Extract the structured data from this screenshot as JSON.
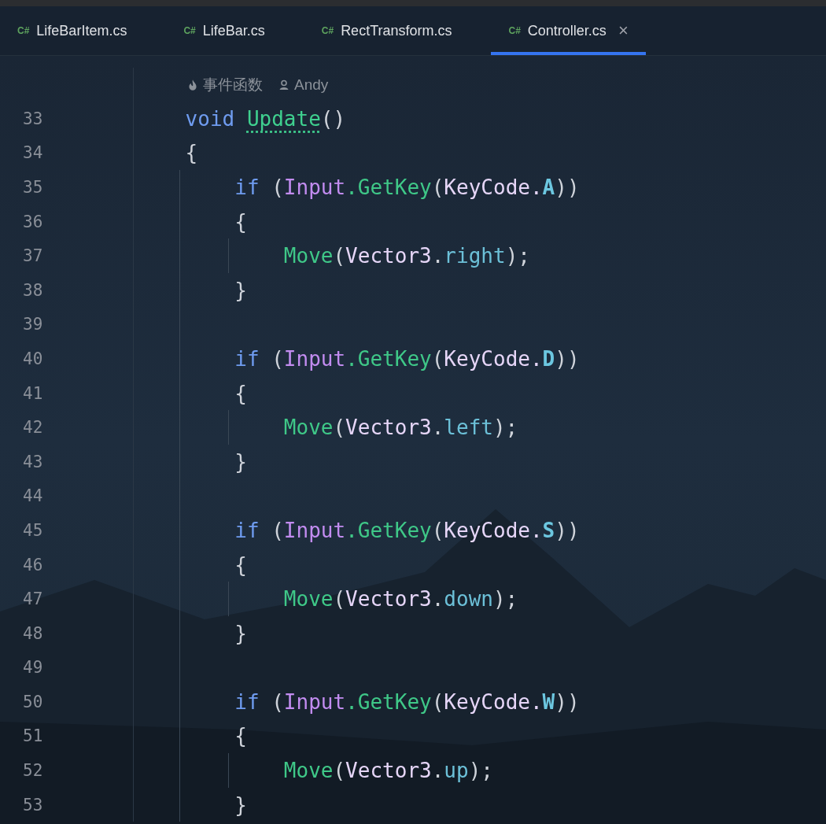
{
  "tabs": [
    {
      "icon": "C#",
      "label": "LifeBarItem.cs",
      "selected": false
    },
    {
      "icon": "C#",
      "label": "LifeBar.cs",
      "selected": false
    },
    {
      "icon": "C#",
      "label": "RectTransform.cs",
      "selected": false
    },
    {
      "icon": "C#",
      "label": "Controller.cs",
      "selected": true,
      "close": "×"
    }
  ],
  "inlay_hints": [
    {
      "kind": "event",
      "text": "事件函数"
    },
    {
      "kind": "author",
      "text": "Andy"
    }
  ],
  "lines": [
    {
      "number": "33",
      "tokens": [
        {
          "kind": "keyword",
          "text": "    void "
        },
        {
          "kind": "method_decl",
          "text": "Update"
        },
        {
          "kind": "punct",
          "text": "()"
        }
      ]
    },
    {
      "number": "34",
      "tokens": [
        {
          "kind": "punct",
          "text": "    {"
        }
      ]
    },
    {
      "number": "35",
      "tokens": [
        {
          "kind": "keyword",
          "text": "        if "
        },
        {
          "kind": "punct",
          "text": "("
        },
        {
          "kind": "class",
          "text": "Input"
        },
        {
          "kind": "method",
          "text": ".GetKey"
        },
        {
          "kind": "punct",
          "text": "("
        },
        {
          "kind": "type",
          "text": "KeyCode."
        },
        {
          "kind": "enum",
          "text": "A"
        },
        {
          "kind": "punct",
          "text": "))"
        }
      ]
    },
    {
      "number": "36",
      "tokens": [
        {
          "kind": "punct",
          "text": "        {"
        }
      ]
    },
    {
      "number": "37",
      "tokens": [
        {
          "kind": "method",
          "text": "            Move"
        },
        {
          "kind": "punct",
          "text": "("
        },
        {
          "kind": "type",
          "text": "Vector3"
        },
        {
          "kind": "punct",
          "text": "."
        },
        {
          "kind": "member",
          "text": "right"
        },
        {
          "kind": "punct",
          "text": ");"
        }
      ]
    },
    {
      "number": "38",
      "tokens": [
        {
          "kind": "punct",
          "text": "        }"
        }
      ]
    },
    {
      "number": "39"
    },
    {
      "number": "40",
      "tokens": [
        {
          "kind": "keyword",
          "text": "        if "
        },
        {
          "kind": "punct",
          "text": "("
        },
        {
          "kind": "class",
          "text": "Input"
        },
        {
          "kind": "method",
          "text": ".GetKey"
        },
        {
          "kind": "punct",
          "text": "("
        },
        {
          "kind": "type",
          "text": "KeyCode."
        },
        {
          "kind": "enum",
          "text": "D"
        },
        {
          "kind": "punct",
          "text": "))"
        }
      ]
    },
    {
      "number": "41",
      "tokens": [
        {
          "kind": "punct",
          "text": "        {"
        }
      ]
    },
    {
      "number": "42",
      "tokens": [
        {
          "kind": "method",
          "text": "            Move"
        },
        {
          "kind": "punct",
          "text": "("
        },
        {
          "kind": "type",
          "text": "Vector3"
        },
        {
          "kind": "punct",
          "text": "."
        },
        {
          "kind": "member",
          "text": "left"
        },
        {
          "kind": "punct",
          "text": ");"
        }
      ]
    },
    {
      "number": "43",
      "tokens": [
        {
          "kind": "punct",
          "text": "        }"
        }
      ]
    },
    {
      "number": "44"
    },
    {
      "number": "45",
      "tokens": [
        {
          "kind": "keyword",
          "text": "        if "
        },
        {
          "kind": "punct",
          "text": "("
        },
        {
          "kind": "class",
          "text": "Input"
        },
        {
          "kind": "method",
          "text": ".GetKey"
        },
        {
          "kind": "punct",
          "text": "("
        },
        {
          "kind": "type",
          "text": "KeyCode."
        },
        {
          "kind": "enum",
          "text": "S"
        },
        {
          "kind": "punct",
          "text": "))"
        }
      ]
    },
    {
      "number": "46",
      "tokens": [
        {
          "kind": "punct",
          "text": "        {"
        }
      ]
    },
    {
      "number": "47",
      "tokens": [
        {
          "kind": "method",
          "text": "            Move"
        },
        {
          "kind": "punct",
          "text": "("
        },
        {
          "kind": "type",
          "text": "Vector3"
        },
        {
          "kind": "punct",
          "text": "."
        },
        {
          "kind": "member",
          "text": "down"
        },
        {
          "kind": "punct",
          "text": ");"
        }
      ]
    },
    {
      "number": "48",
      "tokens": [
        {
          "kind": "punct",
          "text": "        }"
        }
      ]
    },
    {
      "number": "49"
    },
    {
      "number": "50",
      "tokens": [
        {
          "kind": "keyword",
          "text": "        if "
        },
        {
          "kind": "punct",
          "text": "("
        },
        {
          "kind": "class",
          "text": "Input"
        },
        {
          "kind": "method",
          "text": ".GetKey"
        },
        {
          "kind": "punct",
          "text": "("
        },
        {
          "kind": "type",
          "text": "KeyCode."
        },
        {
          "kind": "enum",
          "text": "W"
        },
        {
          "kind": "punct",
          "text": "))"
        }
      ]
    },
    {
      "number": "51",
      "tokens": [
        {
          "kind": "punct",
          "text": "        {"
        }
      ]
    },
    {
      "number": "52",
      "tokens": [
        {
          "kind": "method",
          "text": "            Move"
        },
        {
          "kind": "punct",
          "text": "("
        },
        {
          "kind": "type",
          "text": "Vector3"
        },
        {
          "kind": "punct",
          "text": "."
        },
        {
          "kind": "member",
          "text": "up"
        },
        {
          "kind": "punct",
          "text": ");"
        }
      ]
    },
    {
      "number": "53",
      "tokens": [
        {
          "kind": "punct",
          "text": "        }"
        }
      ]
    }
  ]
}
